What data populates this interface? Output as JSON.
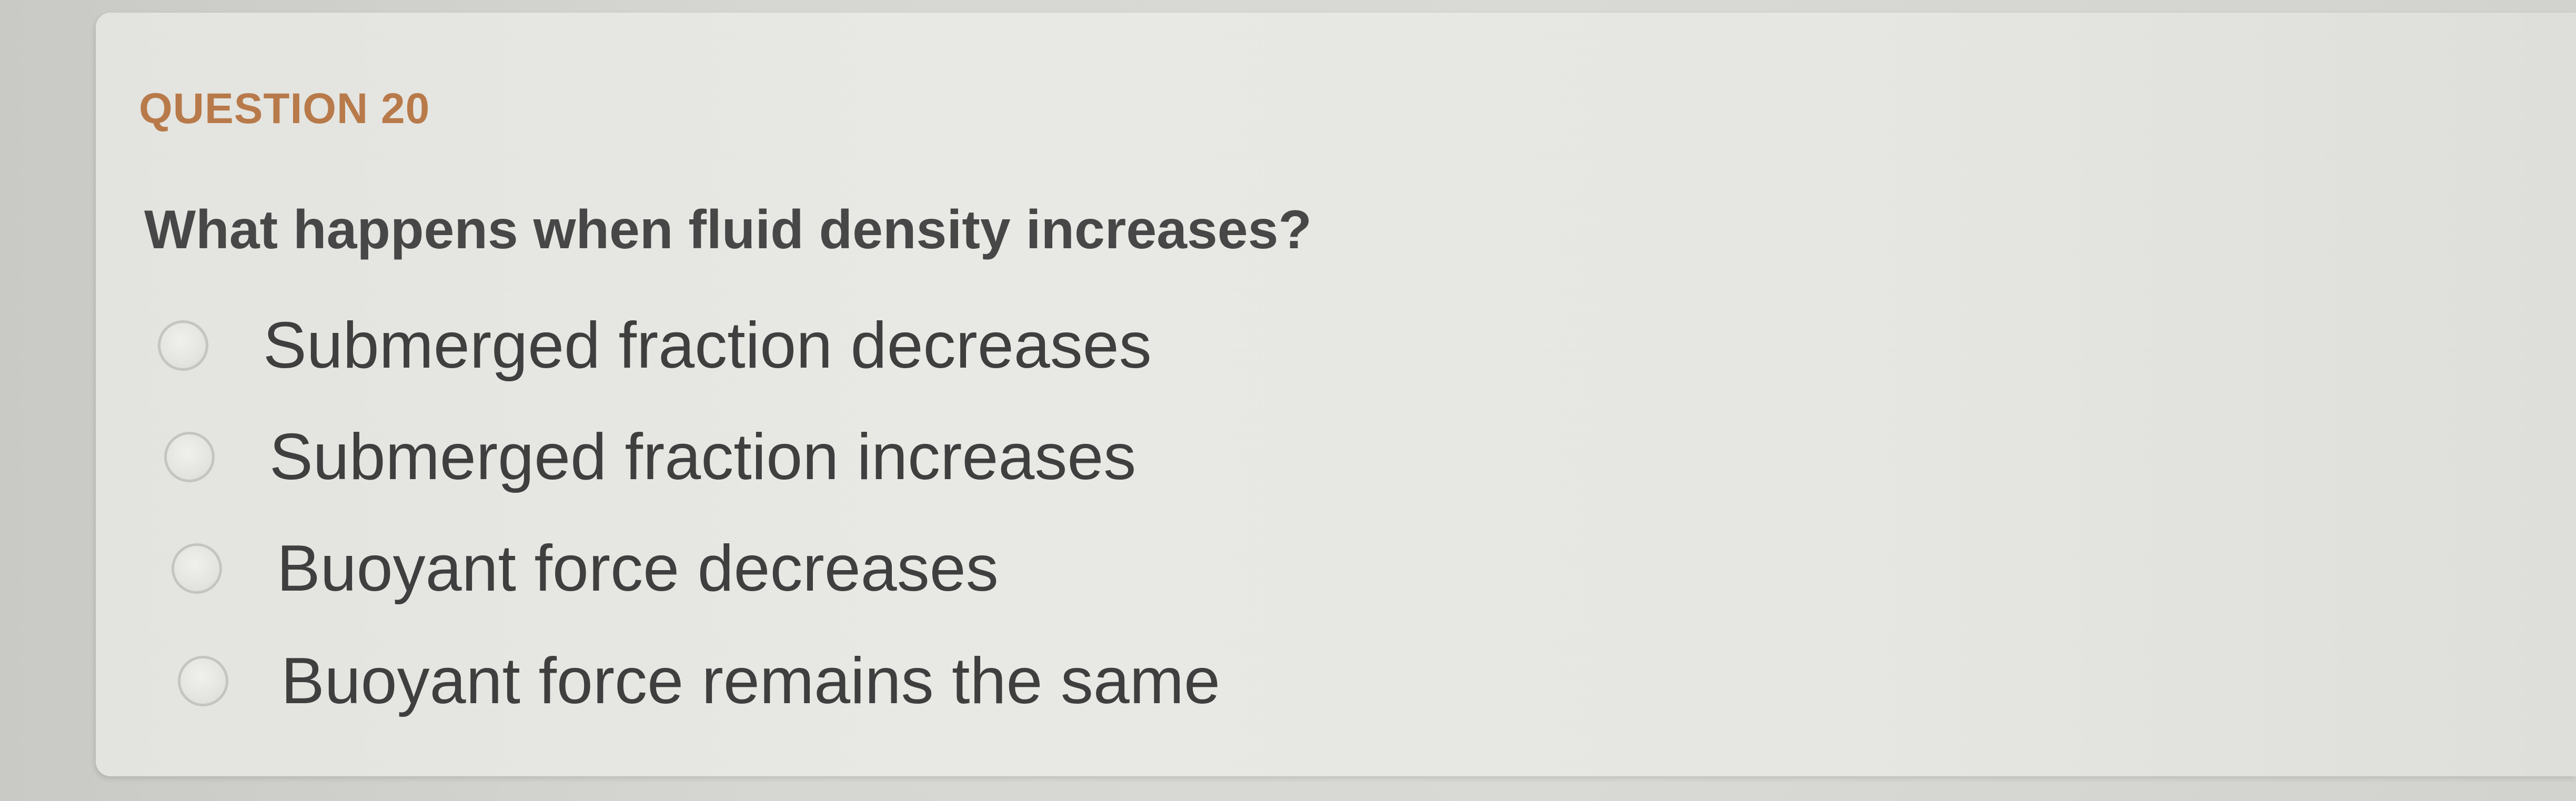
{
  "question": {
    "header": "QUESTION 20",
    "text": "What happens when fluid density increases?",
    "options": [
      {
        "label": "Submerged fraction decreases",
        "selected": false
      },
      {
        "label": "Submerged fraction increases",
        "selected": false
      },
      {
        "label": "Buoyant force decreases",
        "selected": false
      },
      {
        "label": "Buoyant force remains the same",
        "selected": false
      }
    ]
  },
  "colors": {
    "header": "#b87a4a",
    "text": "#474747",
    "card_background": "#e6e6e2"
  }
}
